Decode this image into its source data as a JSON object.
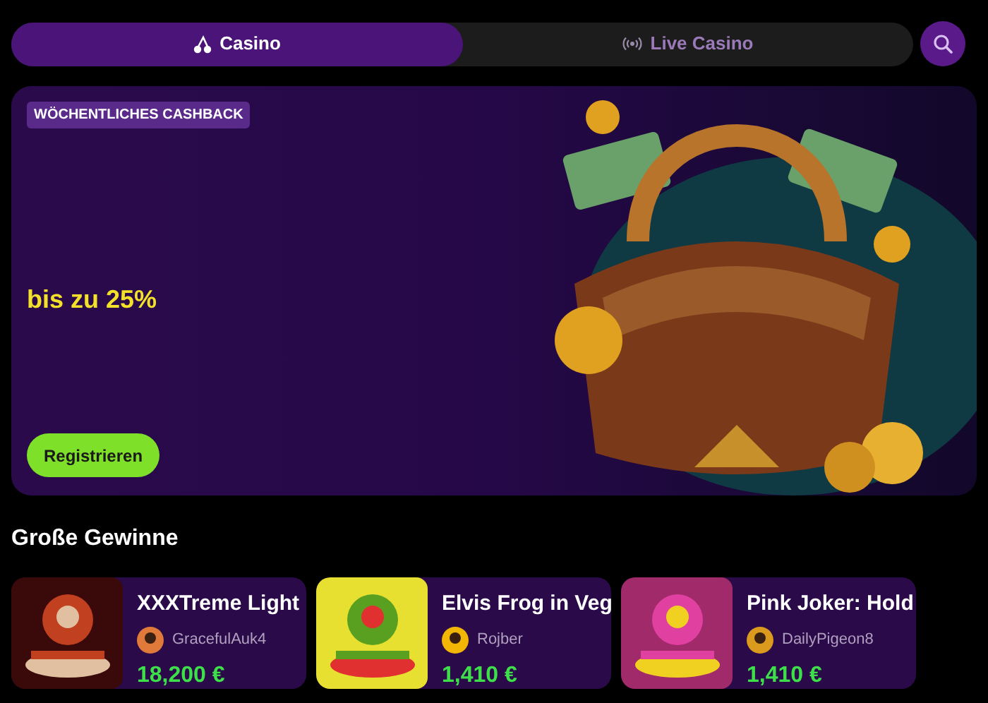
{
  "tabs": [
    {
      "label": "Casino",
      "selected": true
    },
    {
      "label": "Live Casino",
      "selected": false
    }
  ],
  "banner": {
    "badge": "WÖCHENTLICHES CASHBACK",
    "headline": "bis zu 25%",
    "button": "Registrieren"
  },
  "big_wins": {
    "title": "Große Gewinne",
    "items": [
      {
        "game": "XXXTreme Light",
        "player": "GracefulAuk4",
        "amount": "18,200 €"
      },
      {
        "game": "Elvis Frog in Veg",
        "player": "Rojber",
        "amount": "1,410 €"
      },
      {
        "game": "Pink Joker: Hold",
        "player": "DailyPigeon8",
        "amount": "1,410 €"
      }
    ]
  }
}
